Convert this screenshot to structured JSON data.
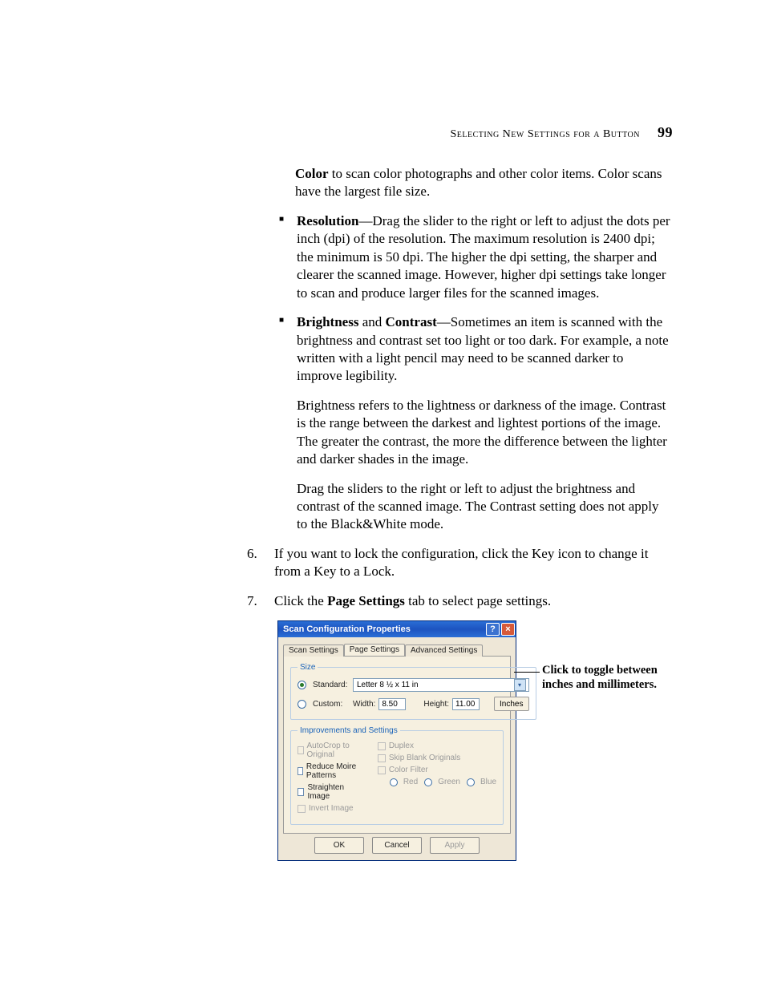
{
  "header": {
    "running_head": "Selecting New Settings for a Button",
    "page_number": "99"
  },
  "body": {
    "color_para": "Color to scan color photographs and other color items. Color scans have the largest file size.",
    "color_bold": "Color",
    "resolution_bold": "Resolution",
    "resolution_text": "—Drag the slider to the right or left to adjust the dots per inch (dpi) of the resolution. The maximum resolution is 2400 dpi; the minimum is 50 dpi. The higher the dpi setting, the sharper and clearer the scanned image. However, higher dpi settings take longer to scan and produce larger files for the scanned images.",
    "brightness_bold": "Brightness",
    "and_word": " and ",
    "contrast_bold": "Contrast",
    "bc_intro": "—Sometimes an item is scanned with the brightness and contrast set too light or too dark. For example, a note written with a light pencil may need to be scanned darker to improve legibility.",
    "bc_para2": "Brightness refers to the lightness or darkness of the image. Contrast is the range between the darkest and lightest portions of the image. The greater the contrast, the more the difference between the lighter and darker shades in the image.",
    "bc_para3": "Drag the sliders to the right or left to adjust the brightness and contrast of the scanned image. The Contrast setting does not apply to the Black&White mode.",
    "step6_num": "6.",
    "step6": "If you want to lock the configuration, click the Key icon to change it from a Key to a Lock.",
    "step7_num": "7.",
    "step7_prefix": "Click the ",
    "step7_bold": "Page Settings",
    "step7_suffix": " tab to select page settings."
  },
  "dialog": {
    "title": "Scan Configuration Properties",
    "tabs": {
      "scan": "Scan Settings",
      "page": "Page Settings",
      "advanced": "Advanced Settings"
    },
    "size": {
      "legend": "Size",
      "standard_label": "Standard:",
      "standard_value": "Letter 8 ½ x 11 in",
      "custom_label": "Custom:",
      "width_label": "Width:",
      "width_value": "8.50",
      "height_label": "Height:",
      "height_value": "11.00",
      "units": "Inches"
    },
    "improve": {
      "legend": "Improvements and Settings",
      "autocrop": "AutoCrop to Original",
      "moire": "Reduce Moire Patterns",
      "straighten": "Straighten Image",
      "invert": "Invert Image",
      "duplex": "Duplex",
      "skip_blank": "Skip Blank Originals",
      "color_filter": "Color Filter",
      "red": "Red",
      "green": "Green",
      "blue": "Blue"
    },
    "buttons": {
      "ok": "OK",
      "cancel": "Cancel",
      "apply": "Apply"
    }
  },
  "callout": {
    "text": "Click to toggle between inches and millimeters."
  }
}
